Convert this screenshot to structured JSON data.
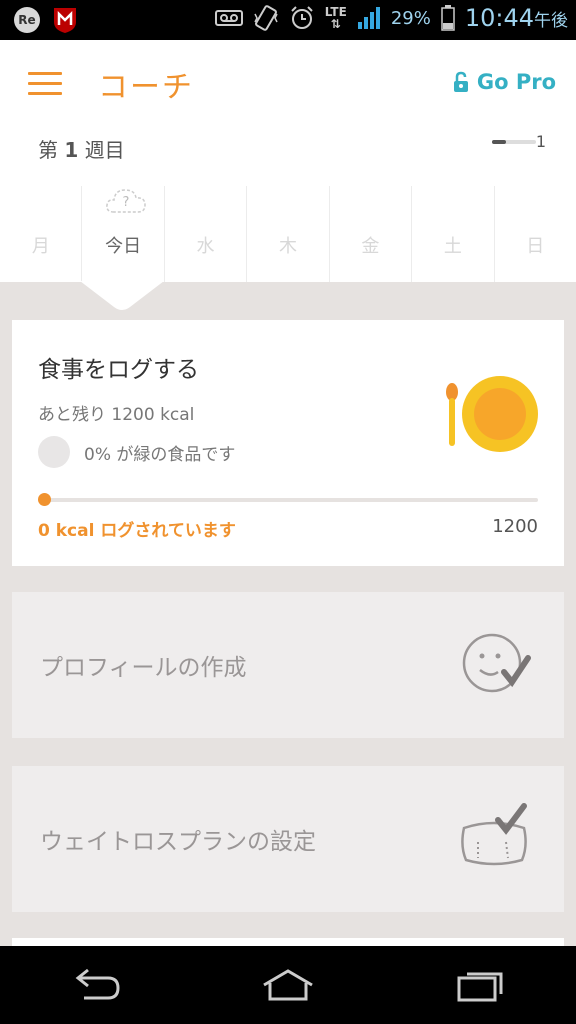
{
  "status_bar": {
    "notification_icons": [
      "re-app-icon",
      "mcafee-icon"
    ],
    "system_icons": [
      "voicemail-icon",
      "vibrate-icon",
      "alarm-icon"
    ],
    "network": "LTE",
    "battery_percent": "29%",
    "time": "10:44",
    "ampm": "午後"
  },
  "app_bar": {
    "title": "コーチ",
    "go_pro_label": "Go Pro",
    "accent_color": "#f0922e",
    "pro_color": "#35b0c4"
  },
  "week": {
    "prefix": "第",
    "number": "1",
    "suffix": "週目",
    "page_indicator": "1"
  },
  "days": [
    {
      "label": "月",
      "today": false
    },
    {
      "label": "今日",
      "today": true,
      "badge": "?"
    },
    {
      "label": "水",
      "today": false
    },
    {
      "label": "木",
      "today": false
    },
    {
      "label": "金",
      "today": false
    },
    {
      "label": "土",
      "today": false
    },
    {
      "label": "日",
      "today": false
    }
  ],
  "meal_card": {
    "title": "食事をログする",
    "remaining": "あと残り 1200 kcal",
    "green_food": "0% が緑の食品です",
    "logged": "0 kcal ログされています",
    "goal": "1200",
    "progress_fraction": 0
  },
  "tasks": [
    {
      "label": "プロフィールの作成",
      "icon": "smiley-check-icon"
    },
    {
      "label": "ウェイトロスプランの設定",
      "icon": "scale-check-icon"
    }
  ],
  "nav_bar": {
    "buttons": [
      "back-icon",
      "home-icon",
      "recent-apps-icon"
    ]
  }
}
